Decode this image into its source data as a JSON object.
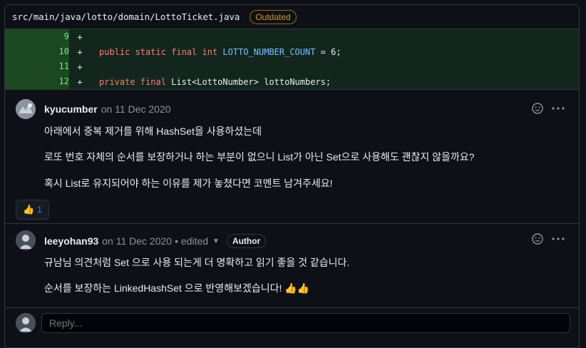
{
  "file": {
    "path": "src/main/java/lotto/domain/LottoTicket.java",
    "status_badge": "Outdated"
  },
  "diff": {
    "lines": [
      {
        "number": "9",
        "sign": "+",
        "code": ""
      },
      {
        "number": "10",
        "sign": "+",
        "code": "public static final int LOTTO_NUMBER_COUNT = 6;"
      },
      {
        "number": "11",
        "sign": "+",
        "code": ""
      },
      {
        "number": "12",
        "sign": "+",
        "code": "private final List<LottoNumber> lottoNumbers;"
      }
    ]
  },
  "comments": [
    {
      "author": "kyucumber",
      "date": "on 11 Dec 2020",
      "paragraphs": [
        "아래에서 중복 제거를 위해 HashSet을 사용하셨는데",
        "로또 번호 자체의 순서를 보장하거나 하는 부분이 없으니 List가 아닌 Set으로 사용해도 괜찮지 않을까요?",
        "혹시 List로 유지되어야 하는 이유를 제가 놓쳤다면 코멘트 남겨주세요!"
      ],
      "reaction": {
        "emoji": "👍",
        "count": "1"
      }
    },
    {
      "author": "leeyohan93",
      "date": "on 11 Dec 2020",
      "edited": "• edited",
      "badge": "Author",
      "paragraphs": [
        "규남님 의견처럼 Set 으로 사용 되는게 더 명확하고 읽기 좋을 것 같습니다.",
        "순서를 보장하는 LinkedHashSet 으로 반영해보겠습니다! 👍👍"
      ]
    }
  ],
  "reply": {
    "placeholder": "Reply..."
  },
  "icons": {
    "emoji": "smiley-icon",
    "more": "kebab-icon"
  }
}
